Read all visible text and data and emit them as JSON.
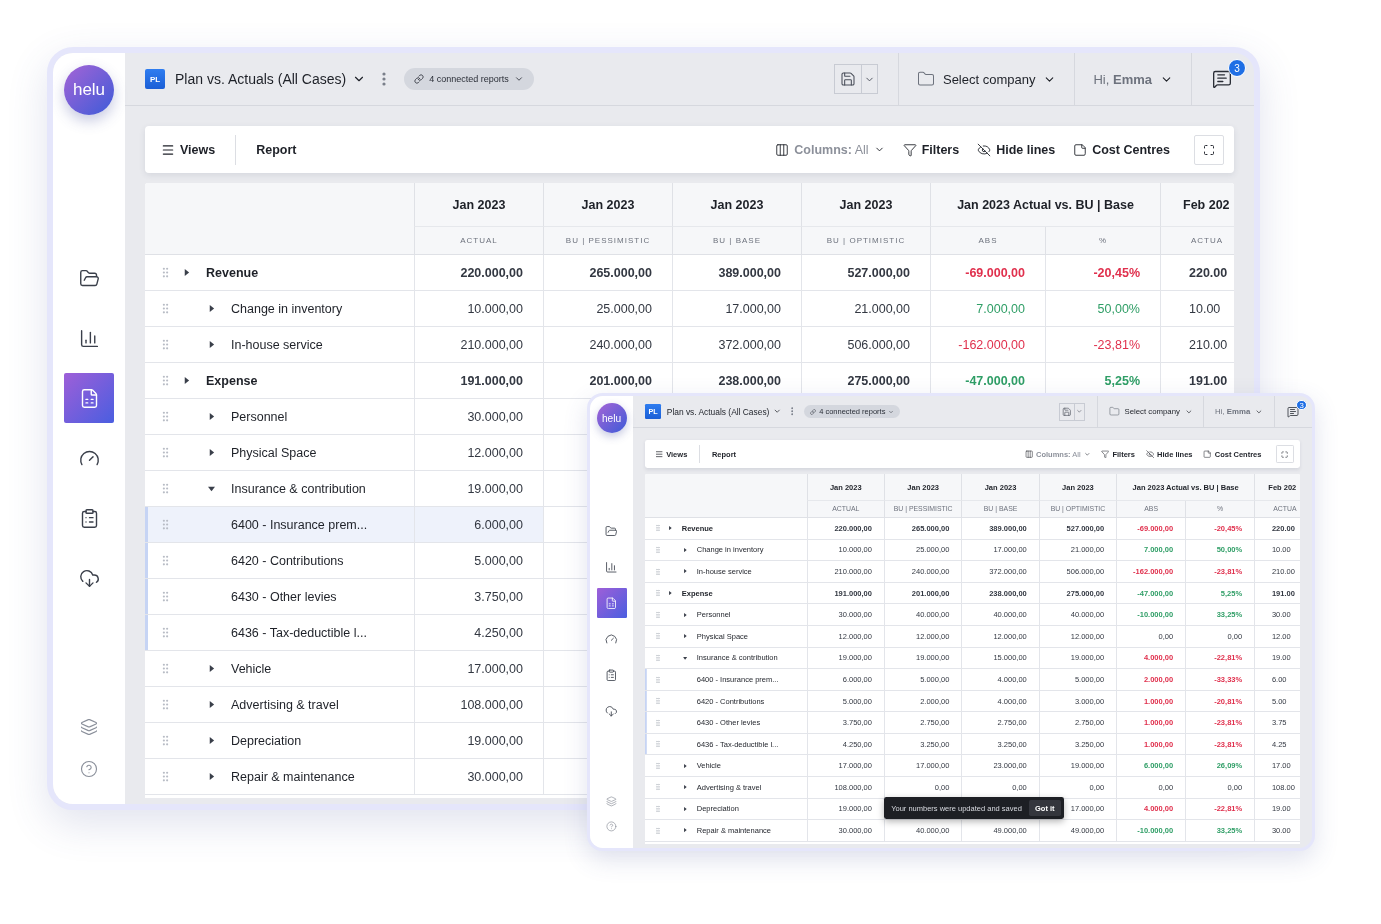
{
  "windows": [
    {
      "logo": "helu",
      "nav": [
        {
          "selected": false
        },
        {
          "selected": false
        },
        {
          "selected": true
        },
        {
          "selected": false
        },
        {
          "selected": false
        },
        {
          "selected": false
        }
      ],
      "header": {
        "badge": "PL",
        "title": "Plan vs. Actuals (All Cases)",
        "connected": "4 connected reports",
        "company": "Select company",
        "greeting": "Hi, **Emma**",
        "notifications": "3"
      },
      "toolbar": {
        "views": "Views",
        "report": "Report",
        "columns": "**Columns:** All",
        "filters": "Filters",
        "hide_lines": "Hide lines",
        "cost_centres": "Cost Centres"
      },
      "table": {
        "column_groups": [
          {
            "title": "Jan 2023",
            "subcolumns": [
              "ACTUAL"
            ]
          },
          {
            "title": "Jan 2023",
            "subcolumns": [
              "BU | PESSIMISTIC"
            ]
          },
          {
            "title": "Jan 2023",
            "subcolumns": [
              "BU | BASE"
            ]
          },
          {
            "title": "Jan 2023",
            "subcolumns": [
              "BU | OPTIMISTIC"
            ]
          },
          {
            "title": "Jan 2023 Actual vs. BU | Base",
            "subcolumns": [
              "ABS",
              "%"
            ]
          },
          {
            "title": "Feb 202",
            "subcolumns": [
              "ACTUA"
            ]
          }
        ],
        "rows": [
          {
            "label": "Revenue",
            "kind": "group",
            "expanded": false,
            "selected": false,
            "cells": [
              "220.000,00",
              "265.000,00",
              "389.000,00",
              "527.000,00",
              {
                "text": "-69.000,00",
                "color": "#e0304d"
              },
              {
                "text": "-20,45%",
                "color": "#e0304d"
              },
              "220.00"
            ]
          },
          {
            "label": "Change in inventory",
            "kind": "item",
            "expanded": false,
            "selected": false,
            "cells": [
              "10.000,00",
              "25.000,00",
              "17.000,00",
              "21.000,00",
              {
                "text": "7.000,00",
                "color": "#2f9e66"
              },
              {
                "text": "50,00%",
                "color": "#2f9e66"
              },
              "10.00"
            ]
          },
          {
            "label": "In-house service",
            "kind": "item",
            "expanded": false,
            "selected": false,
            "cells": [
              "210.000,00",
              "240.000,00",
              "372.000,00",
              "506.000,00",
              {
                "text": "-162.000,00",
                "color": "#e0304d"
              },
              {
                "text": "-23,81%",
                "color": "#e0304d"
              },
              "210.00"
            ]
          },
          {
            "label": "Expense",
            "kind": "group",
            "expanded": false,
            "selected": false,
            "cells": [
              "191.000,00",
              "201.000,00",
              "238.000,00",
              "275.000,00",
              {
                "text": "-47.000,00",
                "color": "#2f9e66"
              },
              {
                "text": "5,25%",
                "color": "#2f9e66"
              },
              "191.00"
            ]
          },
          {
            "label": "Personnel",
            "kind": "item",
            "expanded": false,
            "selected": false,
            "cells": [
              "30.000,00",
              null,
              null,
              null,
              null,
              null,
              null
            ]
          },
          {
            "label": "Physical Space",
            "kind": "item",
            "expanded": false,
            "selected": false,
            "cells": [
              "12.000,00",
              null,
              null,
              null,
              null,
              null,
              null
            ]
          },
          {
            "label": "Insurance & contribution",
            "kind": "item",
            "expanded": true,
            "selected": false,
            "cells": [
              "19.000,00",
              null,
              null,
              null,
              null,
              null,
              null
            ]
          },
          {
            "label": "6400 - Insurance prem...",
            "kind": "account",
            "selected": true,
            "cells": [
              "6.000,00",
              null,
              null,
              null,
              null,
              null,
              null
            ]
          },
          {
            "label": "6420 - Contributions",
            "kind": "account",
            "selected": false,
            "cells": [
              "5.000,00",
              null,
              null,
              null,
              null,
              null,
              null
            ]
          },
          {
            "label": "6430 - Other levies",
            "kind": "account",
            "selected": false,
            "cells": [
              "3.750,00",
              null,
              null,
              null,
              null,
              null,
              null
            ]
          },
          {
            "label": "6436 - Tax-deductible l...",
            "kind": "account",
            "selected": false,
            "cells": [
              "4.250,00",
              null,
              null,
              null,
              null,
              null,
              null
            ]
          },
          {
            "label": "Vehicle",
            "kind": "item",
            "expanded": false,
            "selected": false,
            "cells": [
              "17.000,00",
              null,
              null,
              null,
              null,
              null,
              null
            ]
          },
          {
            "label": "Advertising & travel",
            "kind": "item",
            "expanded": false,
            "selected": false,
            "cells": [
              "108.000,00",
              null,
              null,
              null,
              null,
              null,
              null
            ]
          },
          {
            "label": "Depreciation",
            "kind": "item",
            "expanded": false,
            "selected": false,
            "cells": [
              "19.000,00",
              null,
              null,
              null,
              null,
              null,
              null
            ]
          },
          {
            "label": "Repair & maintenance",
            "kind": "item",
            "expanded": false,
            "selected": false,
            "cells": [
              "30.000,00",
              null,
              null,
              null,
              null,
              null,
              null
            ]
          }
        ]
      }
    },
    {
      "logo": "helu",
      "nav": [
        {
          "selected": false
        },
        {
          "selected": false
        },
        {
          "selected": true
        },
        {
          "selected": false
        },
        {
          "selected": false
        },
        {
          "selected": false
        }
      ],
      "header": {
        "badge": "PL",
        "title": "Plan vs. Actuals (All Cases)",
        "connected": "4 connected reports",
        "company": "Select company",
        "greeting": "Hi, **Emma**",
        "notifications": "3"
      },
      "toolbar": {
        "views": "Views",
        "report": "Report",
        "columns": "**Columns:** All",
        "filters": "Filters",
        "hide_lines": "Hide lines",
        "cost_centres": "Cost Centres"
      },
      "table": {
        "column_groups": [
          {
            "title": "Jan 2023",
            "subcolumns": [
              "ACTUAL"
            ]
          },
          {
            "title": "Jan 2023",
            "subcolumns": [
              "BU | PESSIMISTIC"
            ]
          },
          {
            "title": "Jan 2023",
            "subcolumns": [
              "BU | BASE"
            ]
          },
          {
            "title": "Jan 2023",
            "subcolumns": [
              "BU | OPTIMISTIC"
            ]
          },
          {
            "title": "Jan 2023 Actual vs. BU | Base",
            "subcolumns": [
              "ABS",
              "%"
            ]
          },
          {
            "title": "Feb 202",
            "subcolumns": [
              "ACTUA"
            ]
          }
        ],
        "rows": [
          {
            "label": "Revenue",
            "kind": "group",
            "expanded": false,
            "selected": false,
            "cells": [
              "220.000,00",
              "265.000,00",
              "389.000,00",
              "527.000,00",
              {
                "text": "-69.000,00",
                "color": "#e0304d"
              },
              {
                "text": "-20,45%",
                "color": "#e0304d"
              },
              "220.00"
            ]
          },
          {
            "label": "Change in inventory",
            "kind": "item",
            "expanded": false,
            "selected": false,
            "cells": [
              "10.000,00",
              "25.000,00",
              "17.000,00",
              "21.000,00",
              {
                "text": "7.000,00",
                "color": "#2f9e66"
              },
              {
                "text": "50,00%",
                "color": "#2f9e66"
              },
              "10.00"
            ]
          },
          {
            "label": "In-house service",
            "kind": "item",
            "expanded": false,
            "selected": false,
            "cells": [
              "210.000,00",
              "240.000,00",
              "372.000,00",
              "506.000,00",
              {
                "text": "-162.000,00",
                "color": "#e0304d"
              },
              {
                "text": "-23,81%",
                "color": "#e0304d"
              },
              "210.00"
            ]
          },
          {
            "label": "Expense",
            "kind": "group",
            "expanded": false,
            "selected": false,
            "cells": [
              "191.000,00",
              "201.000,00",
              "238.000,00",
              "275.000,00",
              {
                "text": "-47.000,00",
                "color": "#2f9e66"
              },
              {
                "text": "5,25%",
                "color": "#2f9e66"
              },
              "191.00"
            ]
          },
          {
            "label": "Personnel",
            "kind": "item",
            "expanded": false,
            "selected": false,
            "cells": [
              "30.000,00",
              "40.000,00",
              "40.000,00",
              "40.000,00",
              {
                "text": "-10.000,00",
                "color": "#2f9e66"
              },
              {
                "text": "33,25%",
                "color": "#2f9e66"
              },
              "30.00"
            ]
          },
          {
            "label": "Physical Space",
            "kind": "item",
            "expanded": false,
            "selected": false,
            "cells": [
              "12.000,00",
              "12.000,00",
              "12.000,00",
              "12.000,00",
              "0,00",
              "0,00",
              "12.00"
            ]
          },
          {
            "label": "Insurance & contribution",
            "kind": "item",
            "expanded": true,
            "selected": false,
            "cells": [
              "19.000,00",
              "19.000,00",
              "15.000,00",
              "19.000,00",
              {
                "text": "4.000,00",
                "color": "#e0304d"
              },
              {
                "text": "-22,81%",
                "color": "#e0304d"
              },
              "19.00"
            ]
          },
          {
            "label": "6400 - Insurance prem...",
            "kind": "account",
            "selected": false,
            "cells": [
              "6.000,00",
              "5.000,00",
              "4.000,00",
              "5.000,00",
              {
                "text": "2.000,00",
                "color": "#e0304d"
              },
              {
                "text": "-33,33%",
                "color": "#e0304d"
              },
              "6.00"
            ]
          },
          {
            "label": "6420 - Contributions",
            "kind": "account",
            "selected": false,
            "cells": [
              "5.000,00",
              "2.000,00",
              "4.000,00",
              "3.000,00",
              {
                "text": "1.000,00",
                "color": "#e0304d"
              },
              {
                "text": "-20,81%",
                "color": "#e0304d"
              },
              "5.00"
            ]
          },
          {
            "label": "6430 - Other levies",
            "kind": "account",
            "selected": false,
            "cells": [
              "3.750,00",
              "2.750,00",
              "2.750,00",
              "2.750,00",
              {
                "text": "1.000,00",
                "color": "#e0304d"
              },
              {
                "text": "-23,81%",
                "color": "#e0304d"
              },
              "3.75"
            ]
          },
          {
            "label": "6436 - Tax-deductible l...",
            "kind": "account",
            "selected": false,
            "cells": [
              "4.250,00",
              "3.250,00",
              "3.250,00",
              "3.250,00",
              {
                "text": "1.000,00",
                "color": "#e0304d"
              },
              {
                "text": "-23,81%",
                "color": "#e0304d"
              },
              "4.25"
            ]
          },
          {
            "label": "Vehicle",
            "kind": "item",
            "expanded": false,
            "selected": false,
            "cells": [
              "17.000,00",
              "17.000,00",
              "23.000,00",
              "19.000,00",
              {
                "text": "6.000,00",
                "color": "#2f9e66"
              },
              {
                "text": "26,09%",
                "color": "#2f9e66"
              },
              "17.00"
            ]
          },
          {
            "label": "Advertising & travel",
            "kind": "item",
            "expanded": false,
            "selected": false,
            "cells": [
              "108.000,00",
              "0,00",
              "0,00",
              "0,00",
              "0,00",
              "0,00",
              "108.00"
            ]
          },
          {
            "label": "Depreciation",
            "kind": "item",
            "expanded": false,
            "selected": false,
            "cells": [
              "19.000,00",
              null,
              null,
              "17.000,00",
              {
                "text": "4.000,00",
                "color": "#e0304d"
              },
              {
                "text": "-22,81%",
                "color": "#e0304d"
              },
              "19.00"
            ]
          },
          {
            "label": "Repair & maintenance",
            "kind": "item",
            "expanded": false,
            "selected": false,
            "cells": [
              "30.000,00",
              "40.000,00",
              "49.000,00",
              "49.000,00",
              {
                "text": "-10.000,00",
                "color": "#2f9e66"
              },
              {
                "text": "33,25%",
                "color": "#2f9e66"
              },
              "30.00"
            ]
          }
        ]
      },
      "toast": {
        "text": "Your numbers were updated and saved",
        "button": "Got it"
      }
    }
  ]
}
